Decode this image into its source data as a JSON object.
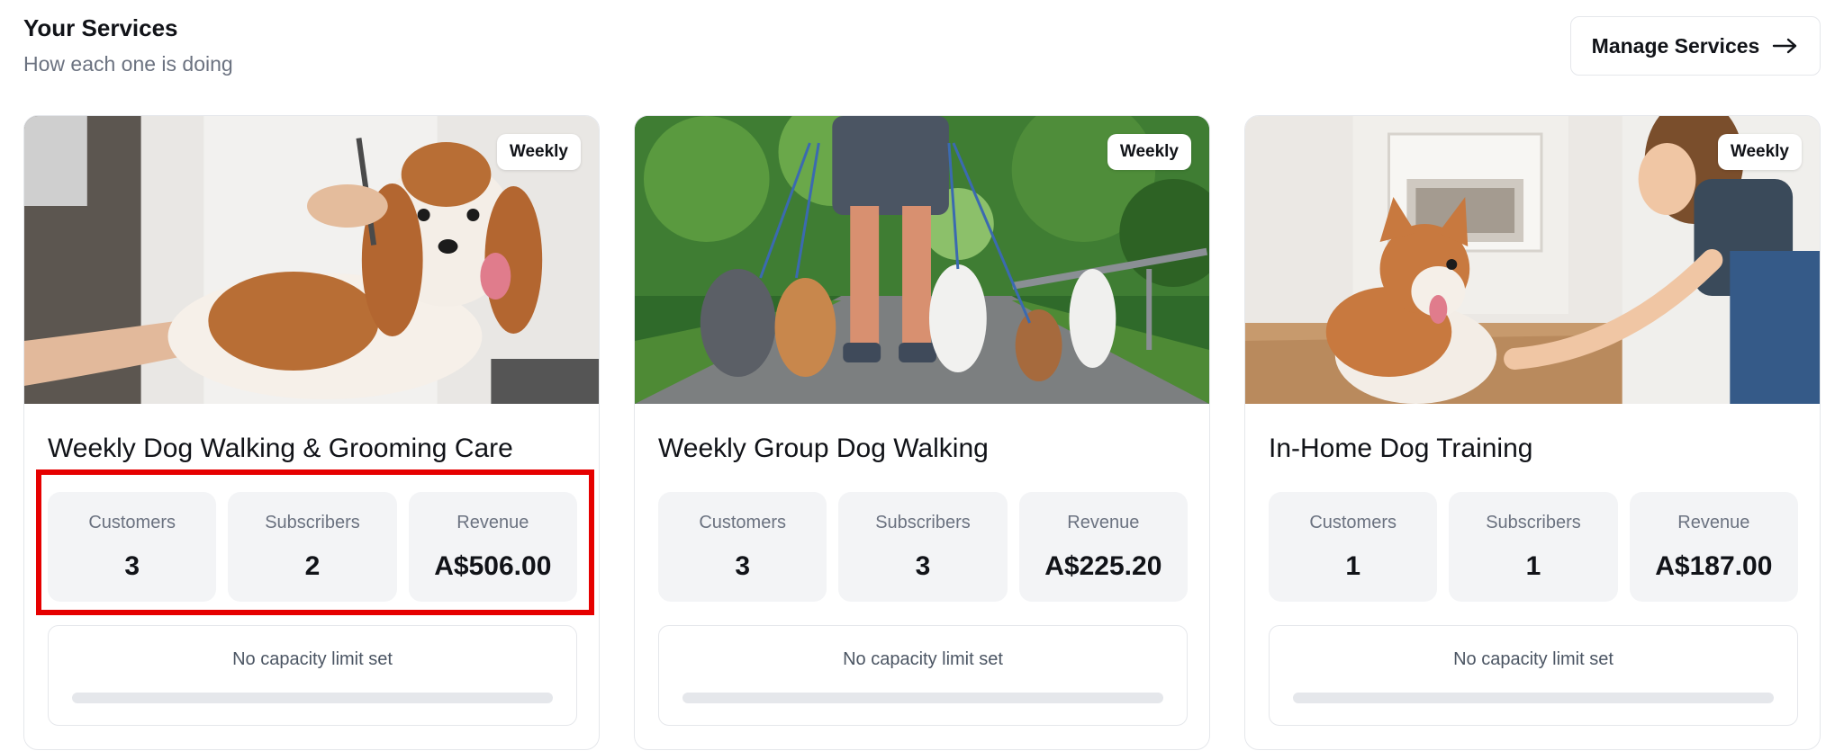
{
  "header": {
    "title": "Your Services",
    "subtitle": "How each one is doing",
    "manage_label": "Manage Services",
    "manage_icon": "arrow-right-icon"
  },
  "cards": [
    {
      "badge": "Weekly",
      "title": "Weekly Dog Walking & Grooming Care",
      "image": "photo-dog-grooming",
      "stats": [
        {
          "label": "Customers",
          "value": "3"
        },
        {
          "label": "Subscribers",
          "value": "2"
        },
        {
          "label": "Revenue",
          "value": "A$506.00"
        }
      ],
      "capacity_text": "No capacity limit set",
      "capacity_fill": 0
    },
    {
      "badge": "Weekly",
      "title": "Weekly Group Dog Walking",
      "image": "photo-group-dog-walking",
      "stats": [
        {
          "label": "Customers",
          "value": "3"
        },
        {
          "label": "Subscribers",
          "value": "3"
        },
        {
          "label": "Revenue",
          "value": "A$225.20"
        }
      ],
      "capacity_text": "No capacity limit set",
      "capacity_fill": 0
    },
    {
      "badge": "Weekly",
      "title": "In-Home Dog Training",
      "image": "photo-dog-training",
      "stats": [
        {
          "label": "Customers",
          "value": "1"
        },
        {
          "label": "Subscribers",
          "value": "1"
        },
        {
          "label": "Revenue",
          "value": "A$187.00"
        }
      ],
      "capacity_text": "No capacity limit set",
      "capacity_fill": 0
    }
  ],
  "colors": {
    "highlight": "#e60000",
    "stat_bg": "#f3f4f6",
    "track": "#e5e7eb"
  }
}
